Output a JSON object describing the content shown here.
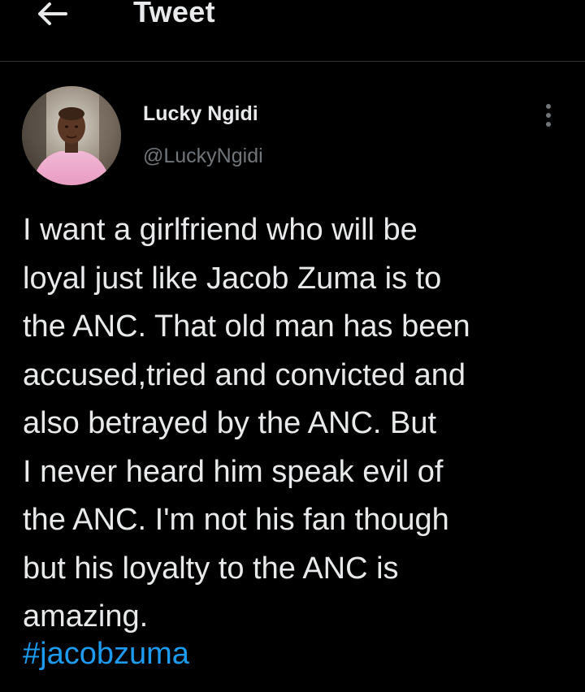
{
  "header": {
    "title": "Tweet",
    "back_icon": "arrow-left-icon"
  },
  "author": {
    "display_name": "Lucky Ngidi",
    "handle": "@LuckyNgidi",
    "avatar_icon": "profile-photo"
  },
  "menu": {
    "icon": "more-vertical-icon"
  },
  "tweet": {
    "text": "I want a girlfriend who will be\nloyal just like Jacob Zuma is to\nthe ANC. That old man has been\naccused,tried and convicted and\nalso betrayed by the ANC. But\nI never heard him speak evil of\nthe ANC. I'm not his fan though\nbut his loyalty to the ANC is\namazing.",
    "hashtag": "#jacobzuma"
  },
  "colors": {
    "background": "#000000",
    "text": "#e7e9ea",
    "secondary": "#71767b",
    "link": "#1d9bf0",
    "divider": "#2f3336"
  }
}
